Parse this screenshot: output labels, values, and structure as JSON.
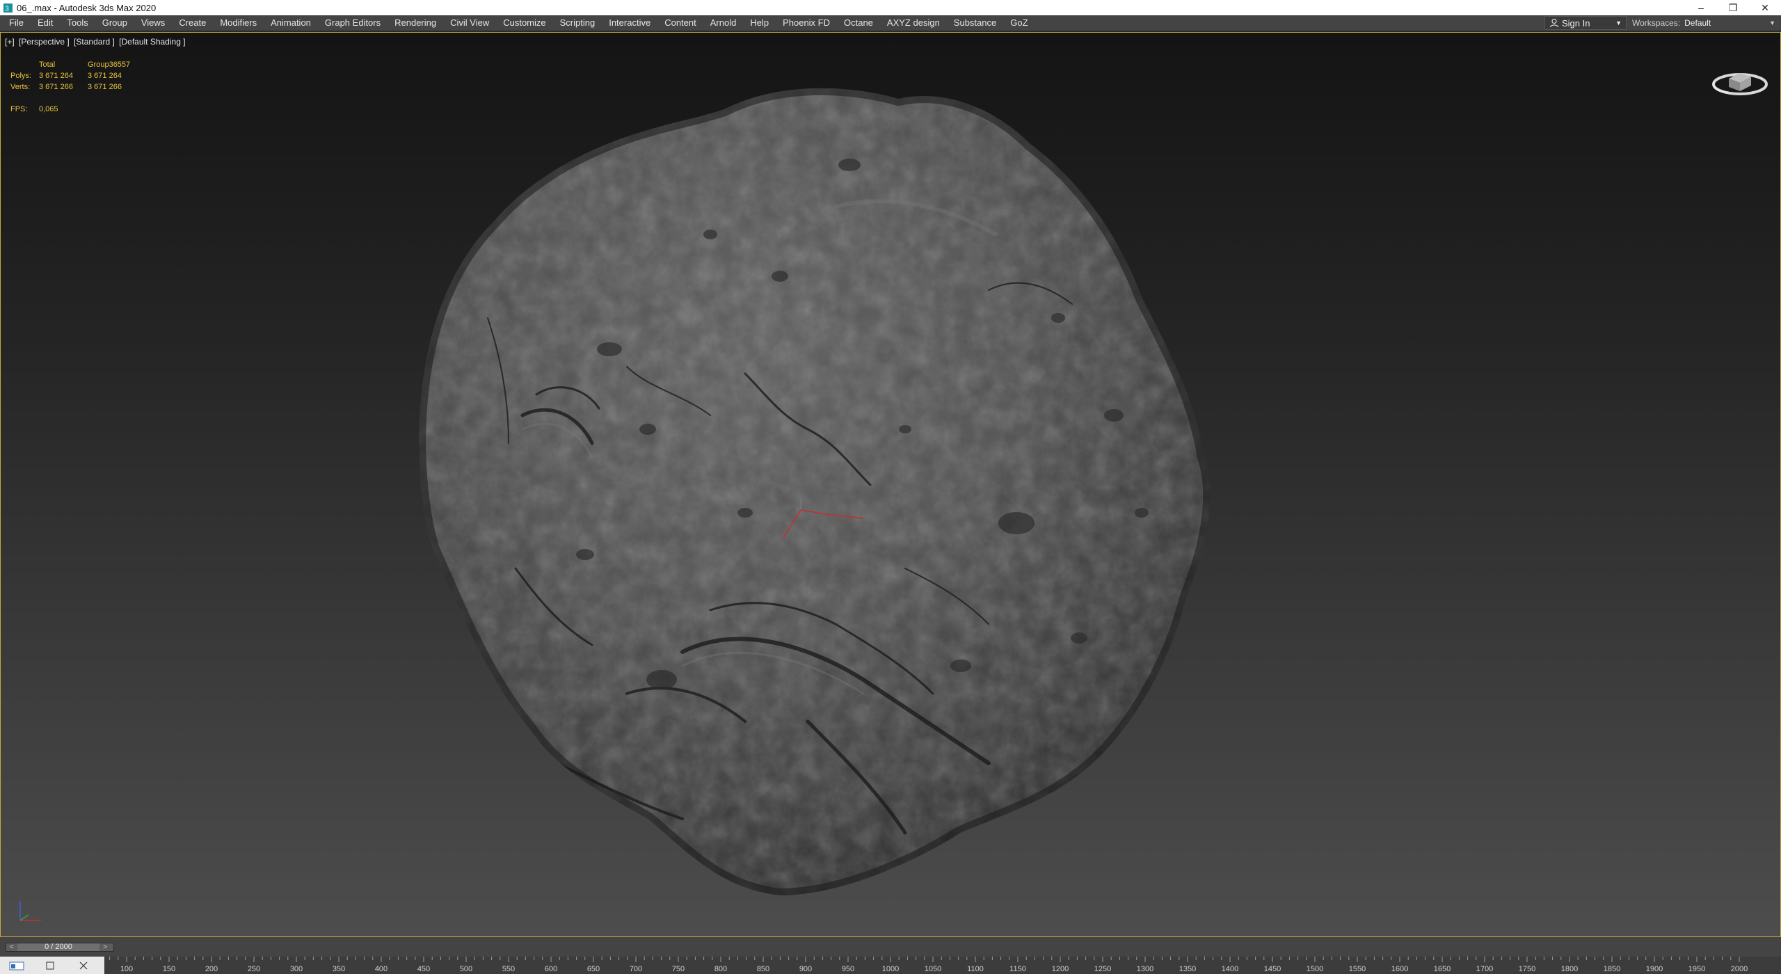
{
  "titlebar": {
    "title": "06_.max - Autodesk 3ds Max 2020",
    "icon": "3ds-max-app-icon",
    "controls": {
      "minimize": "–",
      "restore": "❐",
      "close": "✕"
    }
  },
  "menubar": {
    "items": [
      "File",
      "Edit",
      "Tools",
      "Group",
      "Views",
      "Create",
      "Modifiers",
      "Animation",
      "Graph Editors",
      "Rendering",
      "Civil View",
      "Customize",
      "Scripting",
      "Interactive",
      "Content",
      "Arnold",
      "Help",
      "Phoenix FD",
      "Octane",
      "AXYZ design",
      "Substance",
      "GoZ"
    ],
    "signin": "Sign In",
    "workspaces_label": "Workspaces:",
    "workspaces_value": "Default"
  },
  "viewport": {
    "label": {
      "plus": "[+]",
      "view": "[Perspective ]",
      "mode": "[Standard ]",
      "shading": "[Default Shading ]"
    },
    "stats": {
      "header_total": "Total",
      "header_group": "Group36557",
      "polys_label": "Polys:",
      "polys_total": "3 671 264",
      "polys_group": "3 671 264",
      "verts_label": "Verts:",
      "verts_total": "3 671 266",
      "verts_group": "3 671 266",
      "fps_label": "FPS:",
      "fps_value": "0,065"
    }
  },
  "timeline": {
    "frame_display": "0 / 2000",
    "prev_arrow": "<",
    "next_arrow": ">",
    "current_frame": 0,
    "total_frames": 2000,
    "ruler_ticks": [
      "100",
      "150",
      "200",
      "250",
      "300",
      "350",
      "400",
      "450",
      "500",
      "550",
      "600",
      "650",
      "700",
      "750",
      "800",
      "850",
      "900",
      "950",
      "1000",
      "1050",
      "1100",
      "1150",
      "1200",
      "1250",
      "1300",
      "1350",
      "1400",
      "1450",
      "1500",
      "1550",
      "1600",
      "1650",
      "1700",
      "1750",
      "1800",
      "1850",
      "1900",
      "1950",
      "2000"
    ]
  },
  "colors": {
    "viewport_border": "#c8a83e",
    "stats_text": "#e8c23a",
    "menubar_bg": "#444444"
  }
}
